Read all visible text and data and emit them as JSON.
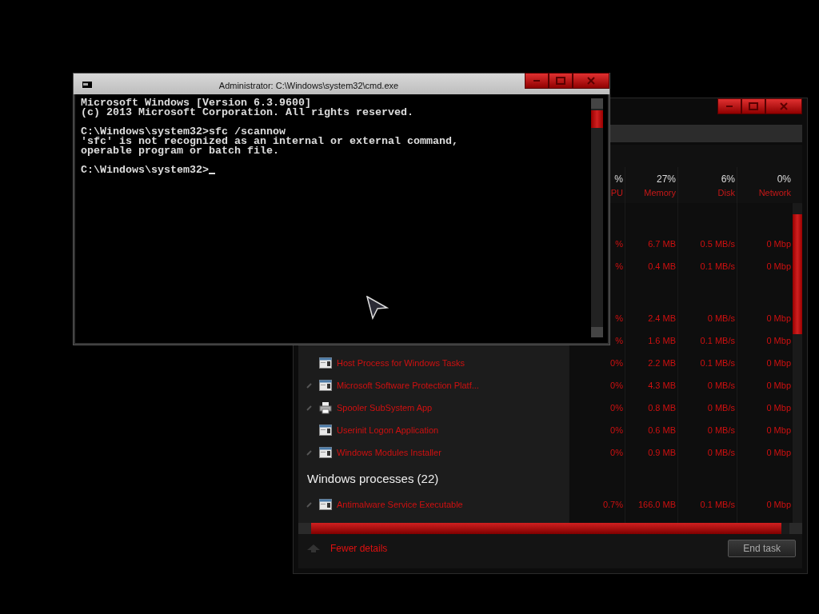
{
  "task_manager": {
    "columns": [
      {
        "percent": "%",
        "label": "PU"
      },
      {
        "percent": "27%",
        "label": "Memory"
      },
      {
        "percent": "6%",
        "label": "Disk"
      },
      {
        "percent": "0%",
        "label": "Network"
      }
    ],
    "groups": [
      {
        "rows": [
          {
            "cpu": "%",
            "memory": "6.7 MB",
            "disk": "0.5 MB/s",
            "network": "0 Mbp"
          },
          {
            "cpu": "%",
            "memory": "0.4 MB",
            "disk": "0.1 MB/s",
            "network": "0 Mbp"
          }
        ]
      },
      {
        "rows": [
          {
            "cpu": "%",
            "memory": "2.4 MB",
            "disk": "0 MB/s",
            "network": "0 Mbp"
          },
          {
            "cpu": "%",
            "memory": "1.6 MB",
            "disk": "0.1 MB/s",
            "network": "0 Mbp"
          },
          {
            "name": "Host Process for Windows Tasks",
            "kind": "app",
            "expandable": false,
            "cpu": "0%",
            "memory": "2.2 MB",
            "disk": "0.1 MB/s",
            "network": "0 Mbp"
          },
          {
            "name": "Microsoft Software Protection Platf...",
            "kind": "app",
            "expandable": true,
            "cpu": "0%",
            "memory": "4.3 MB",
            "disk": "0 MB/s",
            "network": "0 Mbp"
          },
          {
            "name": "Spooler SubSystem App",
            "kind": "printer",
            "expandable": true,
            "cpu": "0%",
            "memory": "0.8 MB",
            "disk": "0 MB/s",
            "network": "0 Mbp"
          },
          {
            "name": "Userinit Logon Application",
            "kind": "app",
            "expandable": false,
            "cpu": "0%",
            "memory": "0.6 MB",
            "disk": "0 MB/s",
            "network": "0 Mbp"
          },
          {
            "name": "Windows Modules Installer",
            "kind": "app",
            "expandable": true,
            "cpu": "0%",
            "memory": "0.9 MB",
            "disk": "0 MB/s",
            "network": "0 Mbp"
          }
        ]
      },
      {
        "title": "Windows processes (22)",
        "rows": [
          {
            "name": "Antimalware Service Executable",
            "kind": "app",
            "expandable": true,
            "cpu": "0.7%",
            "memory": "166.0 MB",
            "disk": "0.1 MB/s",
            "network": "0 Mbp"
          }
        ]
      }
    ],
    "footer": {
      "toggle": "Fewer details",
      "button": "End task"
    }
  },
  "cmd": {
    "title": "Administrator: C:\\Windows\\system32\\cmd.exe",
    "blocks": [
      [
        "Microsoft Windows [Version 6.3.9600]",
        "(c) 2013 Microsoft Corporation. All rights reserved."
      ],
      [
        "C:\\Windows\\system32>sfc /scannow",
        "'sfc' is not recognized as an internal or external command,",
        "operable program or batch file."
      ],
      [
        "C:\\Windows\\system32>"
      ]
    ]
  }
}
